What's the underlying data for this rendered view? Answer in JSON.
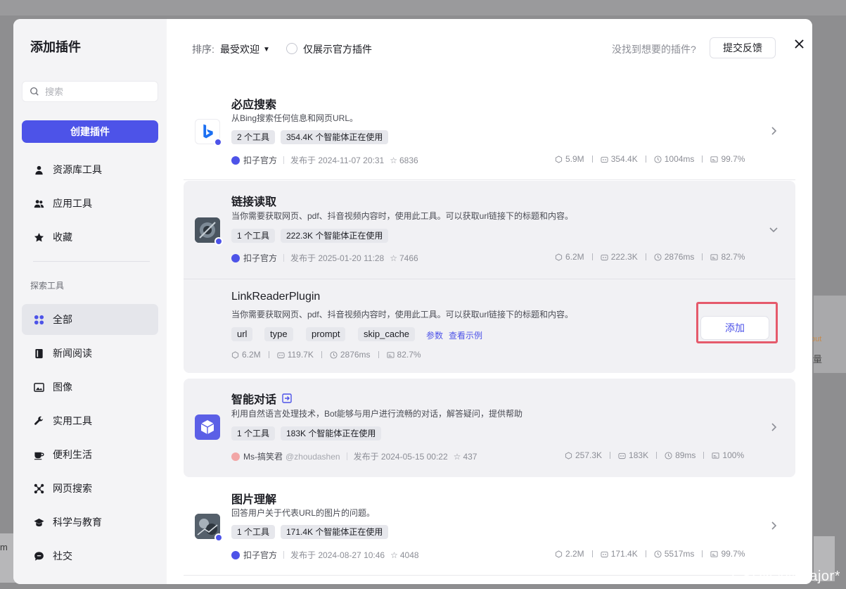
{
  "sidebar": {
    "title": "添加插件",
    "search_placeholder": "搜索",
    "create_label": "创建插件",
    "items": [
      {
        "label": "资源库工具",
        "icon": "user-icon"
      },
      {
        "label": "应用工具",
        "icon": "users-icon"
      },
      {
        "label": "收藏",
        "icon": "star-icon"
      }
    ],
    "section_label": "探索工具",
    "categories": [
      {
        "label": "全部",
        "icon": "grid-icon",
        "active": true
      },
      {
        "label": "新闻阅读",
        "icon": "book-icon"
      },
      {
        "label": "图像",
        "icon": "image-icon"
      },
      {
        "label": "实用工具",
        "icon": "wrench-icon"
      },
      {
        "label": "便利生活",
        "icon": "cup-icon"
      },
      {
        "label": "网页搜索",
        "icon": "network-icon"
      },
      {
        "label": "科学与教育",
        "icon": "graduation-icon"
      },
      {
        "label": "社交",
        "icon": "chat-icon"
      }
    ]
  },
  "toolbar": {
    "sort_label": "排序:",
    "sort_value": "最受欢迎",
    "official_only_label": "仅展示官方插件",
    "feedback_hint": "没找到想要的插件?",
    "feedback_button": "提交反馈"
  },
  "plugins": [
    {
      "name": "必应搜索",
      "desc": "从Bing搜索任何信息和网页URL。",
      "tools_tag": "2 个工具",
      "usage_tag": "354.4K 个智能体正在使用",
      "author": "扣子官方",
      "published": "发布于 2024-11-07 20:31",
      "stars": "6836",
      "stats": [
        "5.9M",
        "354.4K",
        "1004ms",
        "99.7%"
      ]
    },
    {
      "name": "链接读取",
      "desc": "当你需要获取网页、pdf、抖音视频内容时，使用此工具。可以获取url链接下的标题和内容。",
      "tools_tag": "1 个工具",
      "usage_tag": "222.3K 个智能体正在使用",
      "author": "扣子官方",
      "published": "发布于 2025-01-20 11:28",
      "stars": "7466",
      "stats": [
        "6.2M",
        "222.3K",
        "2876ms",
        "82.7%"
      ]
    },
    {
      "name": "智能对话",
      "desc": "利用自然语言处理技术，Bot能够与用户进行流畅的对话，解答疑问，提供帮助",
      "tools_tag": "1 个工具",
      "usage_tag": "183K 个智能体正在使用",
      "author": "Ms-搞笑君",
      "handle": "@zhoudashen",
      "published": "发布于 2024-05-15 00:22",
      "stars": "437",
      "stats": [
        "257.3K",
        "183K",
        "89ms",
        "100%"
      ]
    },
    {
      "name": "图片理解",
      "desc": "回答用户关于代表URL的图片的问题。",
      "tools_tag": "1 个工具",
      "usage_tag": "171.4K 个智能体正在使用",
      "author": "扣子官方",
      "published": "发布于 2024-08-27 10:46",
      "stars": "4048",
      "stats": [
        "2.2M",
        "171.4K",
        "5517ms",
        "99.7%"
      ]
    }
  ],
  "tool": {
    "name": "LinkReaderPlugin",
    "desc": "当你需要获取网页、pdf、抖音视频内容时，使用此工具。可以获取url链接下的标题和内容。",
    "params": [
      "url",
      "type",
      "prompt",
      "skip_cache"
    ],
    "params_link": "参数",
    "example_link": "查看示例",
    "stats": [
      "6.2M",
      "119.7K",
      "2876ms",
      "82.7%"
    ],
    "add_label": "添加"
  },
  "background": {
    "left_text": "m",
    "right_out": "put",
    "right_char": "量"
  },
  "watermark": "CSDN @*Major*",
  "colors": {
    "accent": "#4d53e8",
    "highlight_outline": "#e55a6b"
  }
}
